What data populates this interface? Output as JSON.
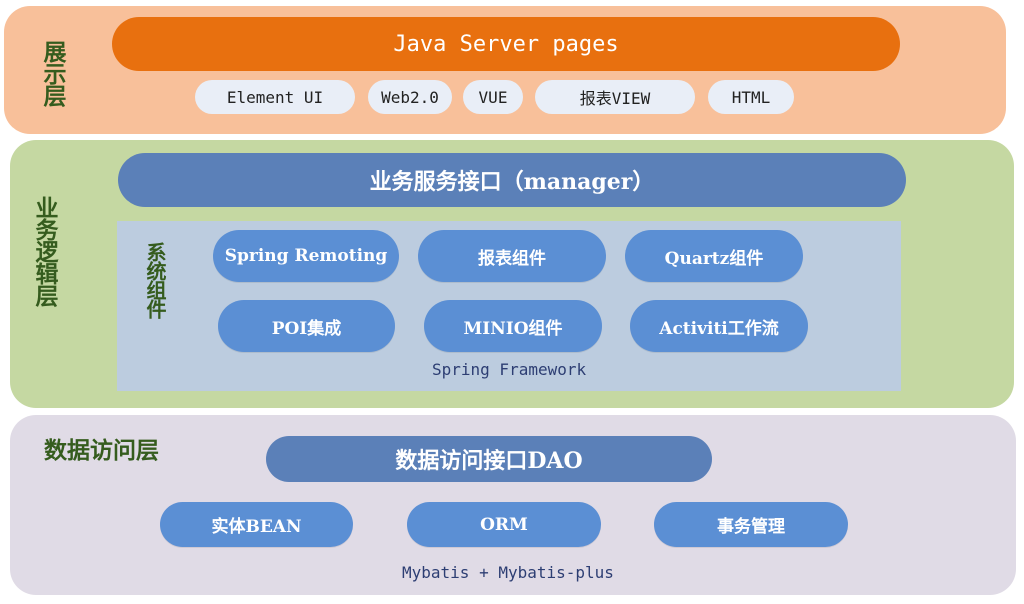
{
  "presentation_layer": {
    "label": "展示层",
    "header": "Java Server pages",
    "items": [
      "Element UI",
      "Web2.0",
      "VUE",
      "报表VIEW",
      "HTML"
    ]
  },
  "business_layer": {
    "label": "业务逻辑层",
    "header": "业务服务接口（manager）",
    "system_components_label": "系统组件",
    "components": [
      "Spring Remoting",
      "报表组件",
      "Quartz组件",
      "POI集成",
      "MINIO组件",
      "Activiti工作流"
    ],
    "framework_caption": "Spring Framework"
  },
  "data_layer": {
    "label": "数据访问层",
    "header": "数据访问接口DAO",
    "items": [
      "实体BEAN",
      "ORM",
      "事务管理"
    ],
    "caption": "Mybatis + Mybatis-plus"
  },
  "colors": {
    "presentation_bg": "#f8c09a",
    "presentation_header": "#e8700f",
    "business_bg": "#c5d8a2",
    "data_bg": "#e0dbe6",
    "header_blue": "#5b80b8",
    "component_blue": "#5b8fd4",
    "framework_bg": "#bcccdf"
  }
}
